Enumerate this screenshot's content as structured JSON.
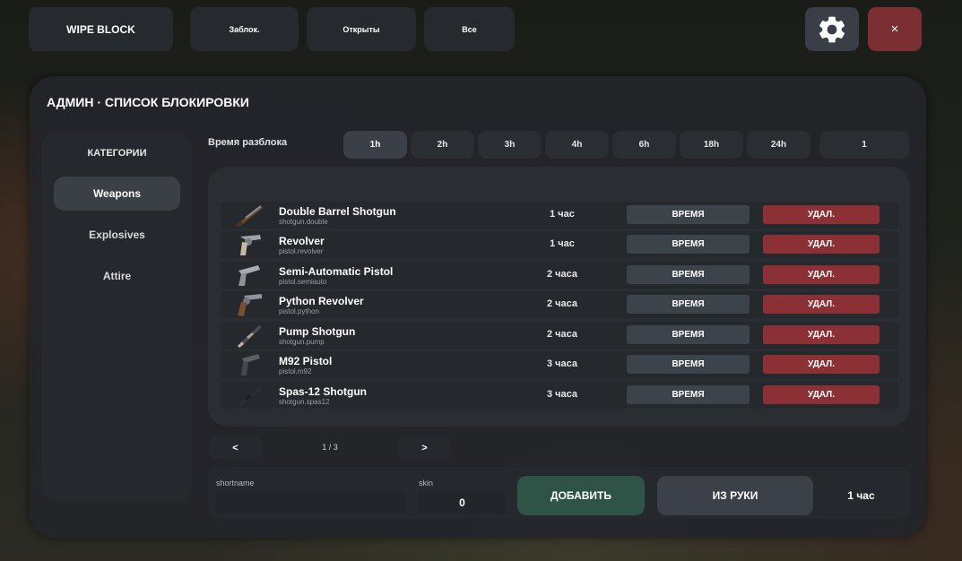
{
  "topbar": {
    "wipe_label": "WIPE BLOCK",
    "filters": [
      "Заблок.",
      "Открыты",
      "Все"
    ],
    "settings_icon": "gear-icon",
    "close_icon": "close-icon",
    "close_symbol": "×"
  },
  "panel": {
    "title": "АДМИН · СПИСОК БЛОКИРОВКИ"
  },
  "categories": {
    "title": "КАТЕГОРИИ",
    "items": [
      {
        "label": "Weapons",
        "active": true
      },
      {
        "label": "Explosives",
        "active": false
      },
      {
        "label": "Attire",
        "active": false
      }
    ]
  },
  "time_filter": {
    "label": "Время разблока",
    "options": [
      "1h",
      "2h",
      "3h",
      "4h",
      "6h",
      "18h",
      "24h",
      "1"
    ],
    "selected": "1h"
  },
  "items": [
    {
      "name": "Double Barrel Shotgun",
      "shortname": "shotgun.double",
      "duration": "1 час",
      "icon": "double-barrel-shotgun-icon"
    },
    {
      "name": "Revolver",
      "shortname": "pistol.revolver",
      "duration": "1 час",
      "icon": "revolver-icon"
    },
    {
      "name": "Semi-Automatic Pistol",
      "shortname": "pistol.semiauto",
      "duration": "2 часа",
      "icon": "semi-automatic-pistol-icon"
    },
    {
      "name": "Python Revolver",
      "shortname": "pistol.python",
      "duration": "2 часа",
      "icon": "python-revolver-icon"
    },
    {
      "name": "Pump Shotgun",
      "shortname": "shotgun.pump",
      "duration": "2 часа",
      "icon": "pump-shotgun-icon"
    },
    {
      "name": "M92 Pistol",
      "shortname": "pistol.m92",
      "duration": "3 часа",
      "icon": "m92-pistol-icon"
    },
    {
      "name": "Spas-12 Shotgun",
      "shortname": "shotgun.spas12",
      "duration": "3 часа",
      "icon": "spas12-shotgun-icon"
    }
  ],
  "row_buttons": {
    "time_label": "ВРЕМЯ",
    "delete_label": "УДАЛ."
  },
  "pagination": {
    "prev": "<",
    "next": ">",
    "page": "1 / 3"
  },
  "add_form": {
    "shortname_label": "shortname",
    "shortname_value": "",
    "skin_label": "skin",
    "skin_value": "0",
    "add_label": "ДОБАВИТЬ",
    "from_hand_label": "ИЗ РУКИ",
    "time_value": "1 час"
  },
  "colors": {
    "delete": "#8b3136",
    "add": "#2d5446",
    "close": "#7b2f33",
    "settings": "#3a3f47"
  }
}
